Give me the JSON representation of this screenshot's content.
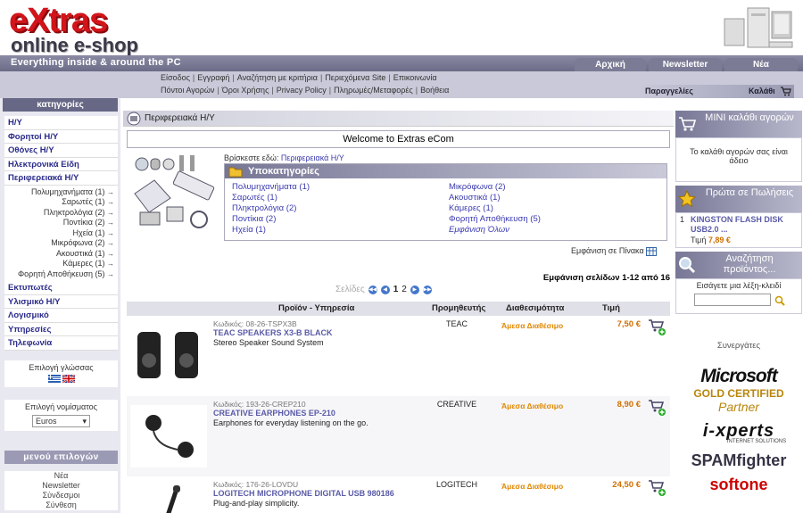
{
  "header": {
    "logo_line1": "eXtras",
    "logo_line2": "online e-shop",
    "tagline": "Everything inside & around the PC",
    "tabs": [
      "Αρχική Σελίδα",
      "Newsletter",
      "Νέα"
    ]
  },
  "nav": {
    "row1": [
      "Είσοδος",
      "Εγγραφή",
      "Αναζήτηση με κριτήρια",
      "Περιεχόμενα Site",
      "Επικοινωνία"
    ],
    "row2": [
      "Πόντοι Αγορών",
      "Όροι Χρήσης",
      "Privacy Policy",
      "Πληρωμές/Μεταφορές",
      "Βοήθεια"
    ],
    "orders": "Παραγγελίες",
    "cart": "Καλάθι"
  },
  "left": {
    "categories_title": "κατηγορίες",
    "categories": [
      {
        "label": "Η/Υ"
      },
      {
        "label": "Φορητοί Η/Υ"
      },
      {
        "label": "Οθόνες Η/Υ"
      },
      {
        "label": "Ηλεκτρονικά Είδη"
      },
      {
        "label": "Περιφερειακά Η/Υ"
      }
    ],
    "subcategories": [
      {
        "label": "Πολυμηχανήματα",
        "count": "(1)"
      },
      {
        "label": "Σαρωτές",
        "count": "(1)"
      },
      {
        "label": "Πληκτρολόγια",
        "count": "(2)"
      },
      {
        "label": "Ποντίκια",
        "count": "(2)"
      },
      {
        "label": "Ηχεία",
        "count": "(1)"
      },
      {
        "label": "Μικρόφωνα",
        "count": "(2)"
      },
      {
        "label": "Ακουστικά",
        "count": "(1)"
      },
      {
        "label": "Κάμερες",
        "count": "(1)"
      },
      {
        "label": "Φορητή Αποθήκευση",
        "count": "(5)"
      }
    ],
    "categories2": [
      {
        "label": "Εκτυπωτές"
      },
      {
        "label": "Υλισμικό Η/Υ"
      },
      {
        "label": "Λογισμικό"
      },
      {
        "label": "Υπηρεσίες"
      },
      {
        "label": "Τηλεφωνία"
      }
    ],
    "language_label": "Επιλογή γλώσσας",
    "currency_label": "Επιλογή νομίσματος",
    "currency_value": "Euros",
    "menu_title": "μενού επιλογών",
    "menu_items": [
      "Νέα",
      "Newsletter",
      "Σύνδεσμοι",
      "Σύνθεση"
    ]
  },
  "main": {
    "crumb_title": "Περιφερειακά Η/Υ",
    "welcome": "Welcome to Extras eCom",
    "you_are_here_label": "Βρίσκεστε εδώ:",
    "you_are_here_value": "Περιφερειακά Η/Υ",
    "subcat_title": "Υποκατηγορίες",
    "subcat_col1": [
      "Πολυμηχανήματα (1)",
      "Σαρωτές (1)",
      "Πληκτρολόγια (2)",
      "Ποντίκια (2)",
      "Ηχεία (1)"
    ],
    "subcat_col2": [
      "Μικρόφωνα (2)",
      "Ακουστικά (1)",
      "Κάμερες (1)",
      "Φορητή Αποθήκευση (5)",
      "Εμφάνιση Όλων"
    ],
    "show_table": "Εμφάνιση σε Πίνακα",
    "show_range": "Εμφάνιση σελίδων 1-12 από 16",
    "pages_label": "Σελίδες",
    "pages": [
      "1",
      "2"
    ],
    "columns": [
      "Προϊόν - Υπηρεσία",
      "Προμηθευτής",
      "Διαθεσιμότητα",
      "Τιμή"
    ],
    "products": [
      {
        "code": "Κωδικός: 08-26-TSPX3B",
        "name": "TEAC SPEAKERS X3-B BLACK",
        "desc": "Stereo Speaker Sound System",
        "supplier": "TEAC",
        "availability": "Άμεσα Διαθέσιμο",
        "price": "7,50 €"
      },
      {
        "code": "Κωδικός: 193-26-CREP210",
        "name": "CREATIVE EARPHONES EP-210",
        "desc": "Earphones for everyday listening on the go.",
        "supplier": "CREATIVE",
        "availability": "Άμεσα Διαθέσιμο",
        "price": "8,90 €"
      },
      {
        "code": "Κωδικός: 176-26-LOVDU",
        "name": "LOGITECH MICROPHONE DIGITAL USB 980186",
        "desc": "Plug-and-play simplicity.",
        "supplier": "LOGITECH",
        "availability": "Άμεσα Διαθέσιμο",
        "price": "24,50 €"
      }
    ]
  },
  "right": {
    "mini_cart_title": "ΜΙΝΙ καλάθι αγορών",
    "mini_cart_text": "Το καλάθι αγορών σας είναι άδειο",
    "bestsellers_title": "Πρώτα σε Πωλήσεις",
    "bestseller_rank": "1",
    "bestseller_name": "KINGSTON FLASH DISK USB2.0 ...",
    "bestseller_price_label": "Τιμή",
    "bestseller_price": "7,89 €",
    "search_title": "Αναζήτηση προϊόντος...",
    "search_label": "Εισάγετε μια λέξη-κλειδί",
    "partners_title": "Συνεργάτες",
    "partner1_line1": "Microsoft",
    "partner1_line2": "GOLD CERTIFIED",
    "partner1_line3": "Partner",
    "partner2": "i-xperts",
    "partner2_sub": "INTERNET SOLUTIONS",
    "partner3": "SPAMfighter",
    "partner4": "softone"
  },
  "colors": {
    "accent": "#676786",
    "link": "#3a3ab0",
    "price": "#d07000",
    "logo_red": "#d3141a"
  }
}
